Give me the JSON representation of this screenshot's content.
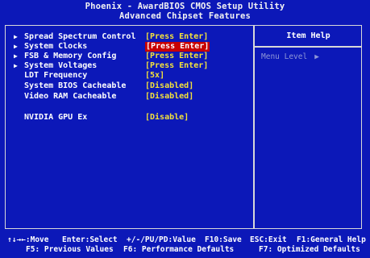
{
  "header": {
    "title": "Phoenix - AwardBIOS CMOS Setup Utility",
    "subtitle": "Advanced Chipset Features"
  },
  "menu": [
    {
      "label": "Spread Spectrum Control",
      "value": "[Press Enter]",
      "submenu": true,
      "selected": false
    },
    {
      "label": "System Clocks",
      "value": "[Press Enter]",
      "submenu": true,
      "selected": true
    },
    {
      "label": "FSB & Memory Config",
      "value": "[Press Enter]",
      "submenu": true,
      "selected": false
    },
    {
      "label": "System Voltages",
      "value": "[Press Enter]",
      "submenu": true,
      "selected": false
    },
    {
      "label": "LDT Frequency",
      "value": "[5x]",
      "submenu": false,
      "selected": false
    },
    {
      "label": "System BIOS Cacheable",
      "value": "[Disabled]",
      "submenu": false,
      "selected": false
    },
    {
      "label": "Video RAM Cacheable",
      "value": "[Disabled]",
      "submenu": false,
      "selected": false
    },
    {
      "label": "NVIDIA GPU Ex",
      "value": "[Disable]",
      "submenu": false,
      "selected": false
    }
  ],
  "help_panel": {
    "title": "Item Help",
    "menu_level_label": "Menu Level",
    "menu_level_marker": "▶"
  },
  "footer": {
    "row1": [
      "↑↓→←:Move",
      "Enter:Select",
      "+/-/PU/PD:Value",
      "F10:Save",
      "ESC:Exit",
      "F1:General Help"
    ],
    "row2": [
      "F5: Previous Values",
      "F6: Performance Defaults",
      "F7: Optimized Defaults"
    ]
  },
  "colors": {
    "background": "#0c18b8",
    "value_text": "#f4e23a",
    "selection_highlight": "#c80000",
    "label_text": "#ffffff"
  }
}
